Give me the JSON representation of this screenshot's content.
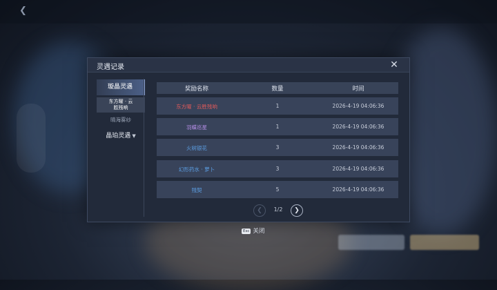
{
  "background": {
    "back_icon": "back-arrow-icon",
    "colors": {
      "dialog_bg": "#222a3a",
      "active_tab": "#4b5f86",
      "red": "#e05a5a",
      "purple": "#b28ce3",
      "blue": "#5c9fe4"
    }
  },
  "dialog": {
    "title": "灵遇记录",
    "close_icon": "close-icon"
  },
  "sidebar": {
    "active_tab": "璇晶灵遇",
    "sub_item": "东方曜 · 云\n胜残响",
    "sub_item2": "晴海雾纱",
    "group": "晶珀灵遇"
  },
  "table": {
    "headers": {
      "name": "奖励名称",
      "qty": "数量",
      "time": "时间"
    },
    "rows": [
      {
        "name": "东方曜 · 云胜残响",
        "qty": "1",
        "time": "2026-4-19 04:06:36",
        "color": "red"
      },
      {
        "name": "羽蝶巡星",
        "qty": "1",
        "time": "2026-4-19 04:06:36",
        "color": "purple"
      },
      {
        "name": "火树银花",
        "qty": "3",
        "time": "2026-4-19 04:06:36",
        "color": "blue"
      },
      {
        "name": "幻形药水 · 萝卜",
        "qty": "3",
        "time": "2026-4-19 04:06:36",
        "color": "blue"
      },
      {
        "name": "残契",
        "qty": "5",
        "time": "2026-4-19 04:06:36",
        "color": "blue"
      }
    ]
  },
  "pager": {
    "text": "1/2"
  },
  "footer": {
    "esc_key": "Esc",
    "close_label": "关闭"
  }
}
